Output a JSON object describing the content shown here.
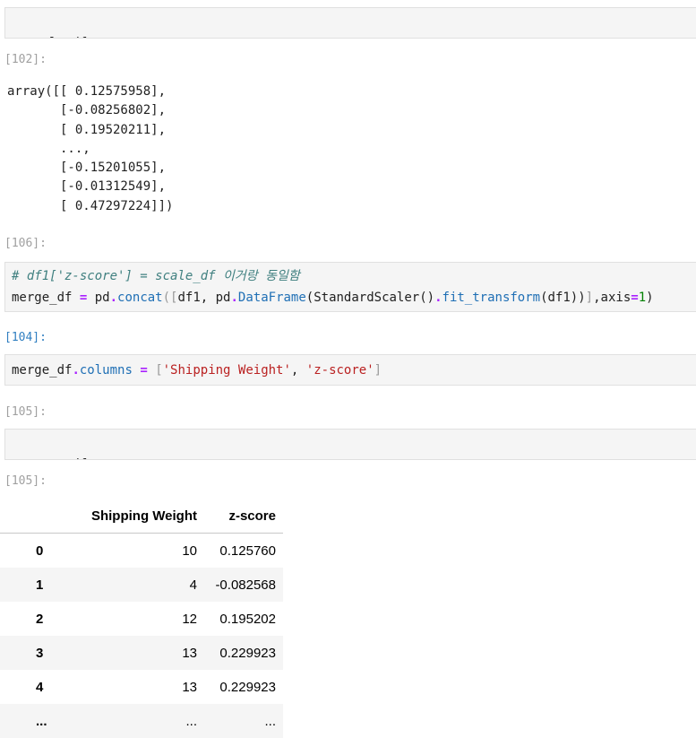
{
  "cells": {
    "c1": {
      "code": "scale_df"
    },
    "c2": {
      "prompt": "[102]:",
      "output": [
        "array([[ 0.12575958],",
        "       [-0.08256802],",
        "       [ 0.19520211],",
        "       ...,",
        "       [-0.15201055],",
        "       [-0.01312549],",
        "       [ 0.47297224]])"
      ]
    },
    "c3": {
      "prompt": "[106]:",
      "comment": "# df1['z-score'] = scale_df 이거랑 동일함",
      "t1": "merge_df ",
      "t2": "=",
      "t3": " pd",
      "t4": ".",
      "t5": "concat",
      "t6": "([",
      "t7": "df1, pd",
      "t8": ".",
      "t9": "DataFrame",
      "t10": "(StandardScaler()",
      "t11": ".",
      "t12": "fit_transform",
      "t13": "(df1))",
      "t14": "]",
      "t15": ",axis",
      "t16": "=",
      "t17": "1",
      "t18": ")"
    },
    "c4": {
      "prompt": "[104]:",
      "t1": "merge_df",
      "t2": ".",
      "t3": "columns",
      "t4": " = ",
      "t5": "[",
      "t6": "'Shipping Weight'",
      "t7": ", ",
      "t8": "'z-score'",
      "t9": "]"
    },
    "c5": {
      "prompt": "[105]:",
      "code": "merge_df"
    },
    "c6": {
      "prompt": "[105]:"
    }
  },
  "dataframe": {
    "columns": [
      "Shipping Weight",
      "z-score"
    ],
    "rows": [
      {
        "index": "0",
        "shipping_weight": "10",
        "z_score": "0.125760"
      },
      {
        "index": "1",
        "shipping_weight": "4",
        "z_score": "-0.082568"
      },
      {
        "index": "2",
        "shipping_weight": "12",
        "z_score": "0.195202"
      },
      {
        "index": "3",
        "shipping_weight": "13",
        "z_score": "0.229923"
      },
      {
        "index": "4",
        "shipping_weight": "13",
        "z_score": "0.229923"
      },
      {
        "index": "...",
        "shipping_weight": "...",
        "z_score": "..."
      }
    ]
  }
}
